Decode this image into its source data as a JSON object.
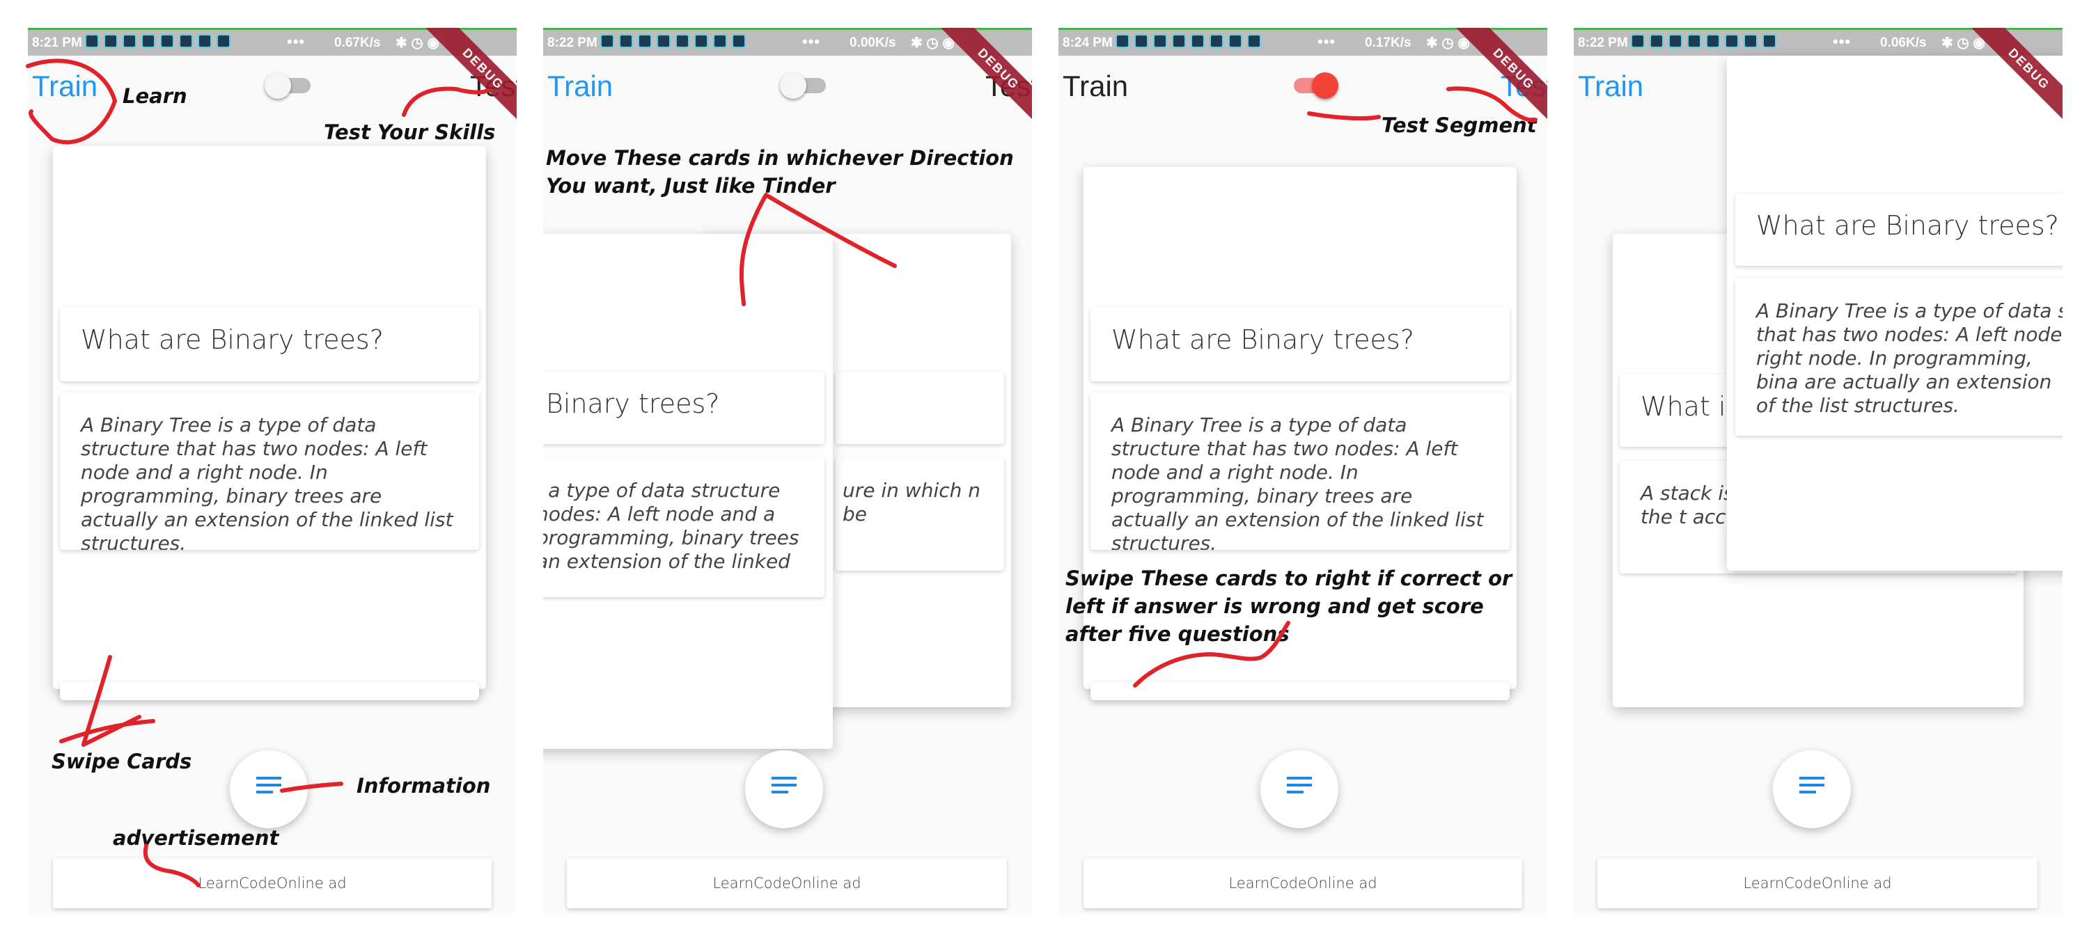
{
  "screens": [
    {
      "status": {
        "time": "8:21 PM",
        "speed": "0.67K/s"
      },
      "debug_label": "DEBUG",
      "train_label": "Train",
      "test_label": "Test",
      "card": {
        "question": "What are Binary trees?",
        "answer": "A Binary Tree is a type of data structure that has two nodes: A left node and a right node. In programming, binary trees are actually an extension of the linked list structures."
      },
      "ad_text": "LearnCodeOnline ad",
      "annotations": {
        "learn": "Learn",
        "test_skills": "Test Your Skills",
        "swipe": "Swipe Cards",
        "info": "Information",
        "ad": "advertisement"
      }
    },
    {
      "status": {
        "time": "8:22 PM",
        "speed": "0.00K/s"
      },
      "debug_label": "DEBUG",
      "train_label": "Train",
      "test_label": "Test",
      "front_card": {
        "question": "Binary trees?",
        "answer": "is a type of data structure nodes: A left node and a programming, binary trees an extension of the linked"
      },
      "back_card": {
        "answer": "ure in which n be"
      },
      "ad_text": "LearnCodeOnline ad",
      "annotations": {
        "move": "Move These cards in whichever Direction You want, Just like Tinder"
      }
    },
    {
      "status": {
        "time": "8:24 PM",
        "speed": "0.17K/s"
      },
      "debug_label": "DEBUG",
      "train_label": "Train",
      "test_label": "Test",
      "card": {
        "question": "What are Binary trees?",
        "answer": "A Binary Tree is a type of data structure that has two nodes: A left node and a right node. In programming, binary trees are actually an extension of the linked list structures."
      },
      "ad_text": "LearnCodeOnline ad",
      "annotations": {
        "segment": "Test Segment",
        "swipe_score": "Swipe These cards to right if correct or left if answer is wrong and get score after five questions"
      }
    },
    {
      "status": {
        "time": "8:22 PM",
        "speed": "0.06K/s"
      },
      "debug_label": "DEBUG",
      "train_label": "Train",
      "front_card": {
        "question": "What are Binary trees?",
        "answer": "A Binary Tree is a type of data s that has two nodes: A left node right node. In programming, bina are actually an extension of the list structures."
      },
      "back_card": {
        "question": "What is",
        "answer": "A stack is only the t accessec"
      },
      "ad_text": "LearnCodeOnline ad"
    }
  ],
  "colors": {
    "accent": "#2196f3",
    "toggle_on": "#f44336",
    "annotation_ink": "#e0232a",
    "debug_banner": "#9c1b2e"
  },
  "icons": {
    "fab": "notes-list-icon",
    "toggle": "toggle-switch"
  }
}
